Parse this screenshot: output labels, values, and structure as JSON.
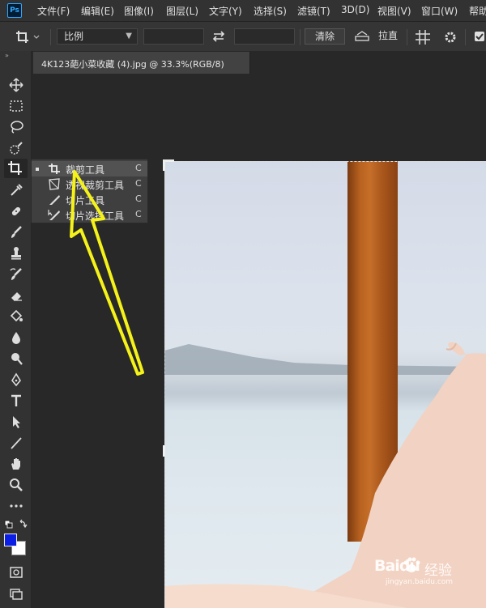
{
  "app": {
    "logo": "Ps"
  },
  "menubar": {
    "items": [
      "文件(F)",
      "编辑(E)",
      "图像(I)",
      "图层(L)",
      "文字(Y)",
      "选择(S)",
      "滤镜(T)",
      "3D(D)",
      "视图(V)",
      "窗口(W)",
      "帮助"
    ]
  },
  "options": {
    "ratio_value": "比例",
    "clear_label": "清除",
    "straighten_label": "拉直",
    "icons": [
      "crop-icon",
      "chevron-down-icon",
      "swap-icon",
      "straighten-icon",
      "grid-icon",
      "gear-icon",
      "checkbox-icon"
    ]
  },
  "document": {
    "tab_title": "4K123葩小菜收藏 (4).jpg @ 33.3%(RGB/8)"
  },
  "flyout": {
    "items": [
      {
        "label": "裁剪工具",
        "shortcut": "C",
        "icon": "crop-icon",
        "selected": true
      },
      {
        "label": "透视裁剪工具",
        "shortcut": "C",
        "icon": "perspective-crop-icon",
        "selected": false
      },
      {
        "label": "切片工具",
        "shortcut": "C",
        "icon": "slice-icon",
        "selected": false
      },
      {
        "label": "切片选择工具",
        "shortcut": "C",
        "icon": "slice-select-icon",
        "selected": false
      }
    ]
  },
  "tools": [
    "move-icon",
    "marquee-icon",
    "lasso-icon",
    "quick-select-icon",
    "crop-icon",
    "eyedropper-icon",
    "healing-icon",
    "brush-icon",
    "stamp-icon",
    "history-brush-icon",
    "eraser-icon",
    "paint-bucket-icon",
    "blur-icon",
    "dodge-icon",
    "pen-icon",
    "type-icon",
    "path-select-icon",
    "line-icon",
    "hand-icon",
    "zoom-icon",
    "more-icon"
  ],
  "colors": {
    "foreground": "#0a1ee6",
    "background": "#ffffff",
    "annotation_arrow": "#f5f21a"
  },
  "watermark": {
    "brand": "Baidu",
    "suffix": "经验",
    "site": "jingyan.baidu.com"
  }
}
